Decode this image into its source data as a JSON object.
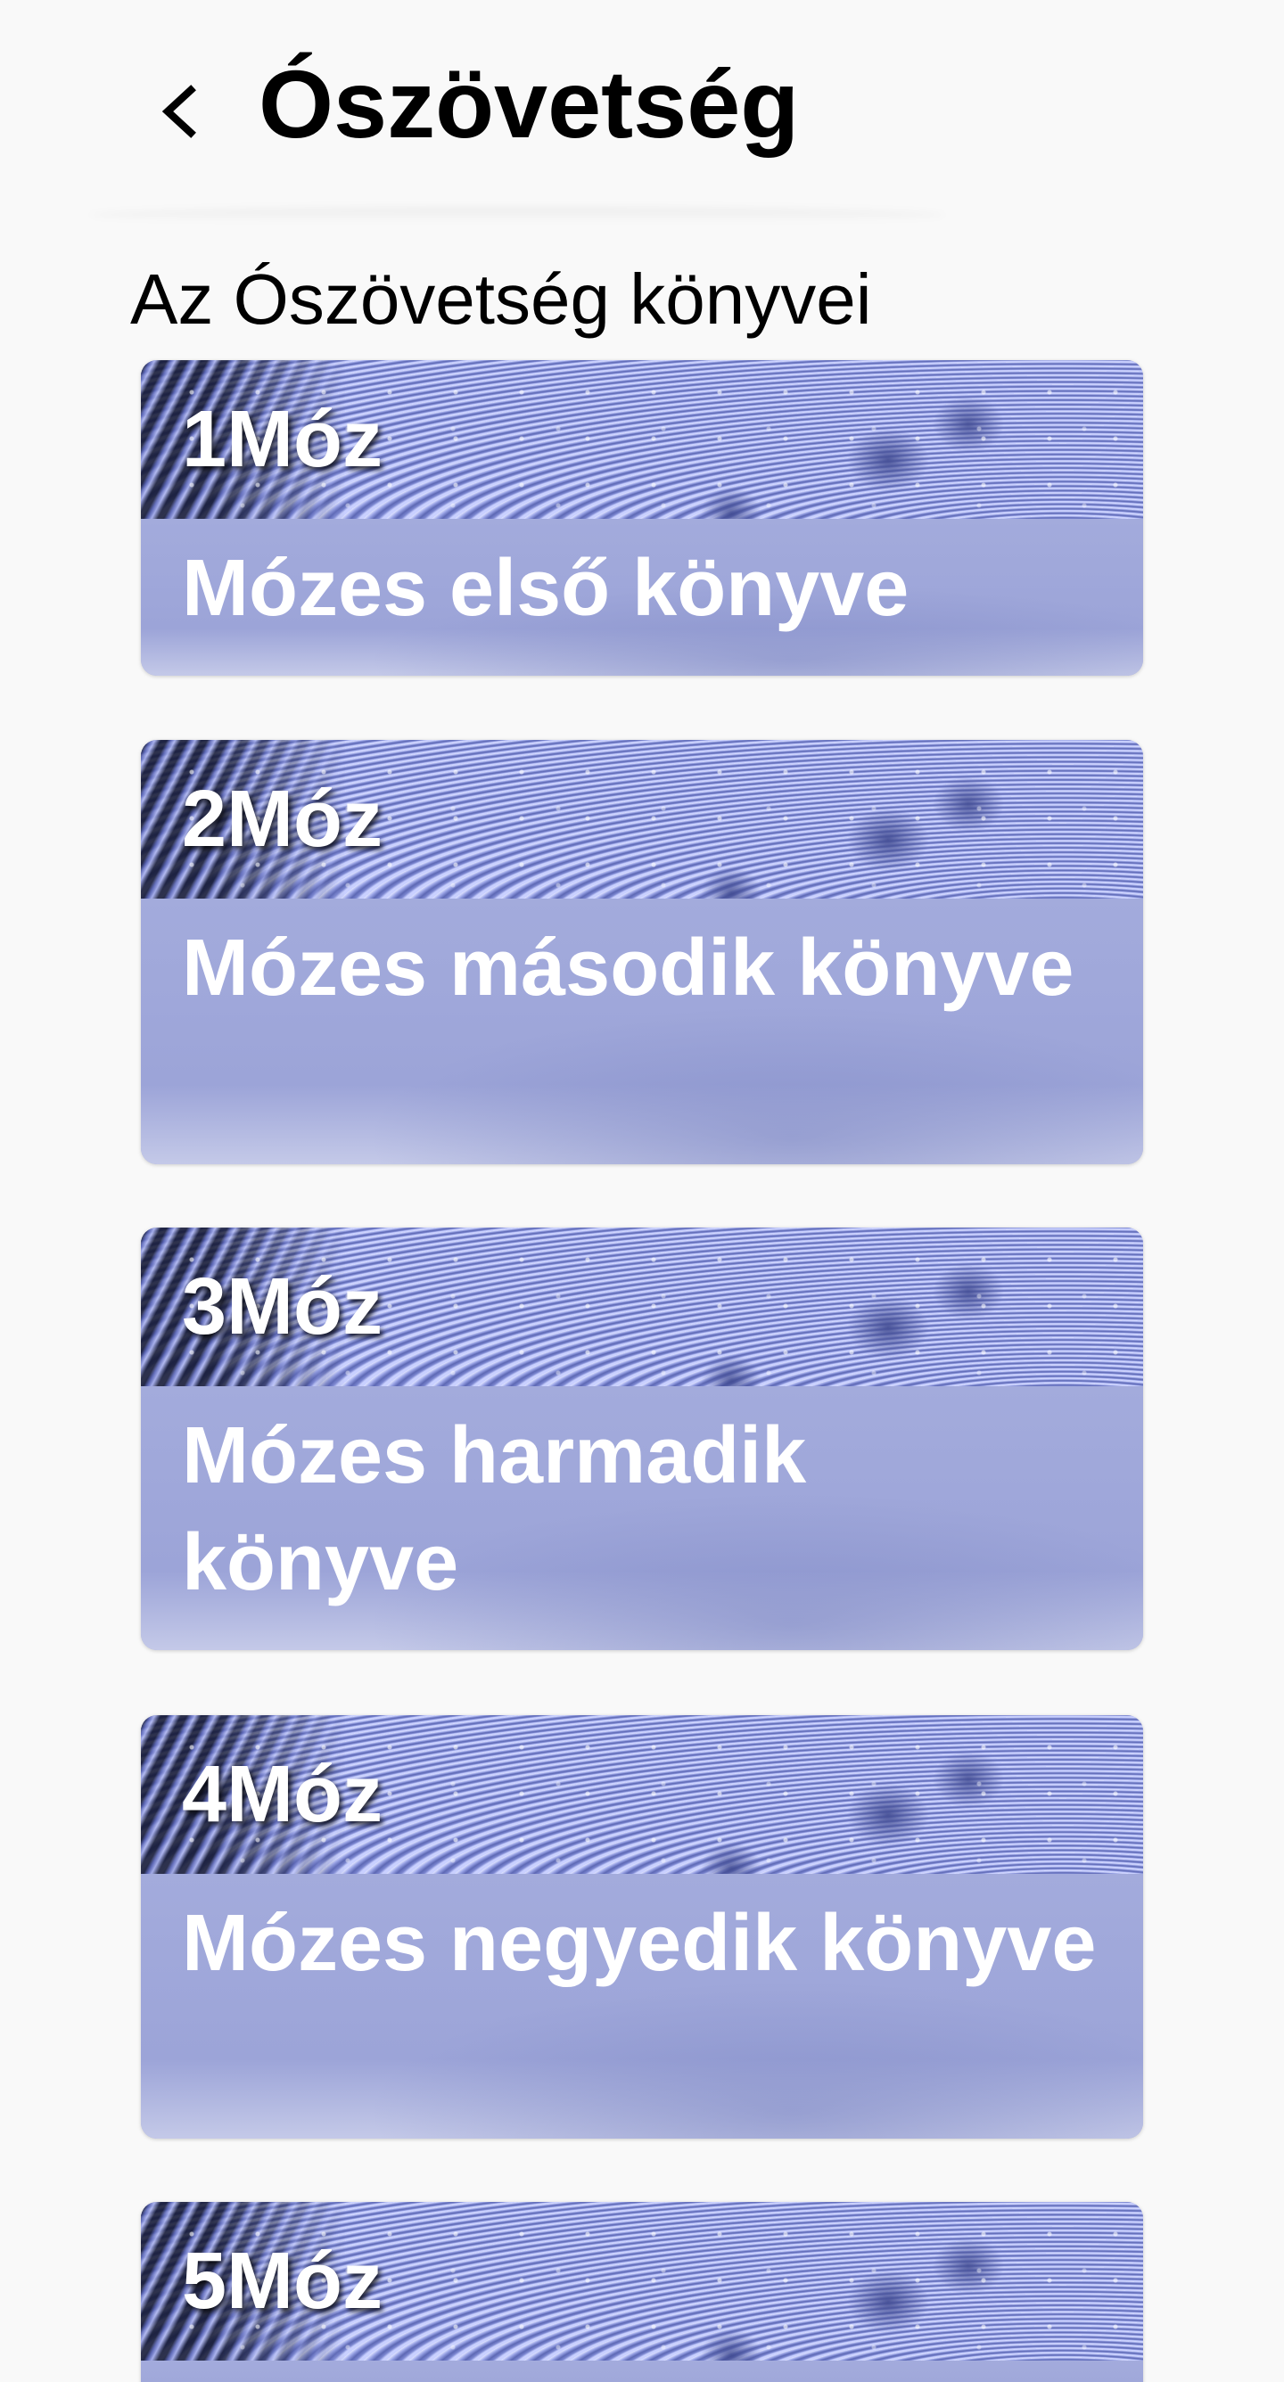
{
  "header": {
    "title": "Ószövetség",
    "back_icon": "chevron-left-icon"
  },
  "section": {
    "title": "Az Ószövetség könyvei"
  },
  "books": [
    {
      "abbr": "1Móz",
      "name": "Mózes első könyve"
    },
    {
      "abbr": "2Móz",
      "name": "Mózes második könyve"
    },
    {
      "abbr": "3Móz",
      "name": "Mózes harmadik könyve"
    },
    {
      "abbr": "4Móz",
      "name": "Mózes negyedik könyve"
    },
    {
      "abbr": "5Móz",
      "name": ""
    }
  ],
  "colors": {
    "background": "#f9f9f9",
    "card_body": "#a1a9dc",
    "card_text": "#ffffff",
    "title_text": "#000000"
  }
}
